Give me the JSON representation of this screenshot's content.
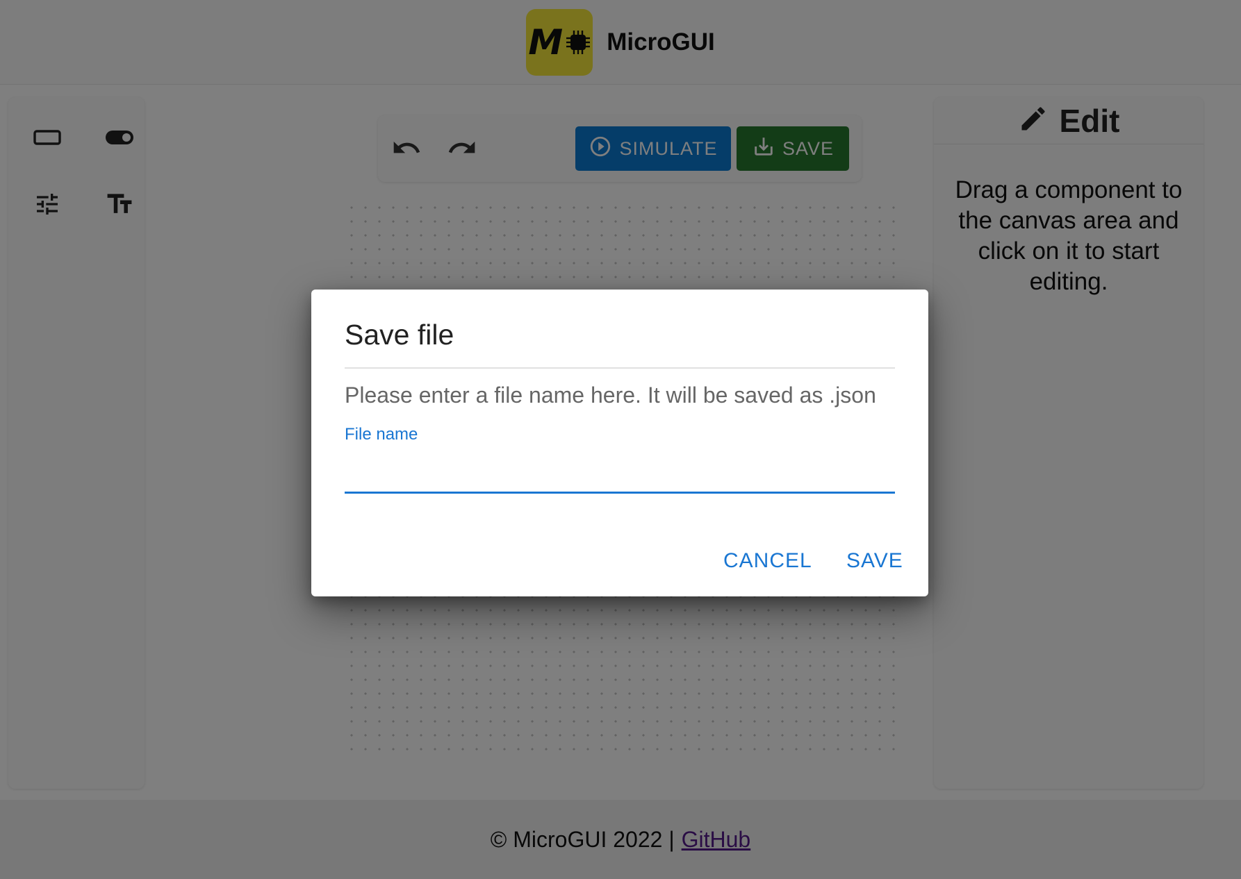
{
  "header": {
    "app_name": "MicroGUI",
    "logo_letter": "M",
    "logo_color": "#f5e63a"
  },
  "toolbox": {
    "items": [
      {
        "name": "button-component",
        "icon": "rectangle-icon"
      },
      {
        "name": "switch-component",
        "icon": "toggle-icon"
      },
      {
        "name": "slider-component",
        "icon": "tune-icon"
      },
      {
        "name": "text-component",
        "icon": "text-fields-icon"
      }
    ]
  },
  "toolbar": {
    "undo_icon": "undo-icon",
    "redo_icon": "redo-icon",
    "simulate_label": "SIMULATE",
    "save_label": "SAVE",
    "simulate_color": "#0b7bd3",
    "save_color": "#27792f"
  },
  "edit_panel": {
    "title": "Edit",
    "icon": "pencil-icon",
    "hint": "Drag a component to the canvas area and click on it to start editing."
  },
  "footer": {
    "copyright": "© MicroGUI 2022 |",
    "link": "GitHub"
  },
  "dialog": {
    "title": "Save file",
    "description": "Please enter a file name here. It will be saved as .json",
    "field_label": "File name",
    "field_value": "",
    "cancel_label": "CANCEL",
    "save_label": "SAVE",
    "accent_color": "#1976d2"
  }
}
